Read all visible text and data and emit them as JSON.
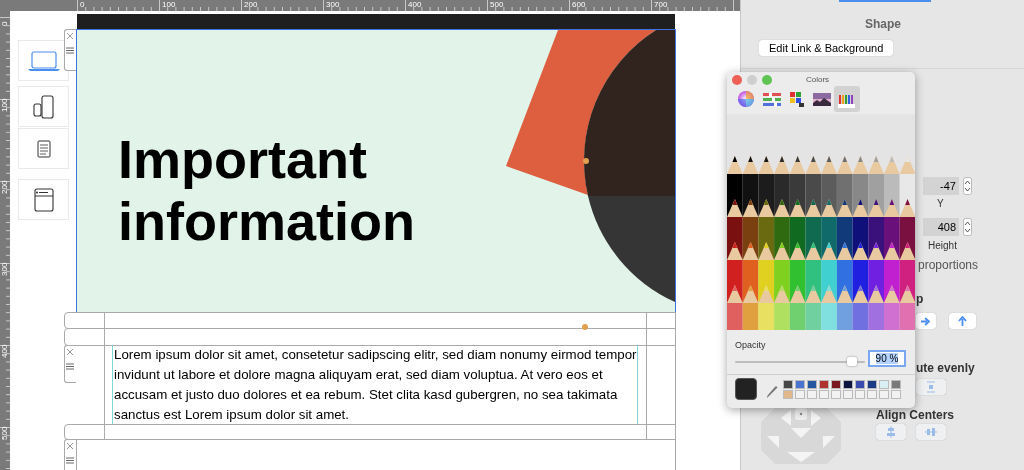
{
  "rulers": {
    "horizontal": [
      "0",
      "100",
      "200",
      "300",
      "400",
      "500",
      "600",
      "700"
    ],
    "vertical": [
      "0",
      "100",
      "200",
      "300",
      "400",
      "500"
    ]
  },
  "device_sidebar": [
    {
      "kind": "laptop",
      "selected": true
    },
    {
      "kind": "phone",
      "selected": false
    },
    {
      "kind": "document",
      "selected": false
    },
    {
      "kind": "browser",
      "selected": false
    }
  ],
  "slide": {
    "title": "Important information",
    "selected": true
  },
  "text_block": {
    "text": "Lorem ipsum dolor sit amet, consetetur sadipscing elitr, sed diam nonumy eirmod tempor invidunt ut labore et dolore magna aliquyam erat, sed diam voluptua. At vero eos et accusam et justo duo dolores et ea rebum. Stet clita kasd gubergren, no sea takimata sanctus est Lorem ipsum dolor sit amet."
  },
  "inspector": {
    "heading": "Shape",
    "link_button": "Edit Link & Background",
    "y_field": "-47",
    "y_label": "Y",
    "height_field": "408",
    "height_label": "Height",
    "proportions_label": "proportions",
    "flip_label": "p",
    "distribute_label": "ute evenly",
    "align_label": "Align Centers"
  },
  "colors_panel": {
    "title": "Colors",
    "tabs": [
      {
        "kind": "wheel",
        "selected": false
      },
      {
        "kind": "sliders",
        "selected": false
      },
      {
        "kind": "palettes",
        "selected": false
      },
      {
        "kind": "image",
        "selected": false
      },
      {
        "kind": "pencils",
        "selected": true
      }
    ],
    "opacity_label": "Opacity",
    "opacity": {
      "level": 0.9
    },
    "opacity_value": "90 %",
    "swatches": [
      {
        "color": "#474747"
      },
      {
        "color": "#4a74d0"
      },
      {
        "color": "#2457a0"
      },
      {
        "color": "#b03330"
      },
      {
        "color": "#7a1522"
      },
      {
        "color": "#0b1540"
      },
      {
        "color": "#3a4bb0"
      },
      {
        "color": "#1d3a88"
      },
      {
        "color": "#d8eef2"
      },
      {
        "color": "#7a7a7a"
      },
      {
        "color": "#e0b88c"
      }
    ]
  }
}
